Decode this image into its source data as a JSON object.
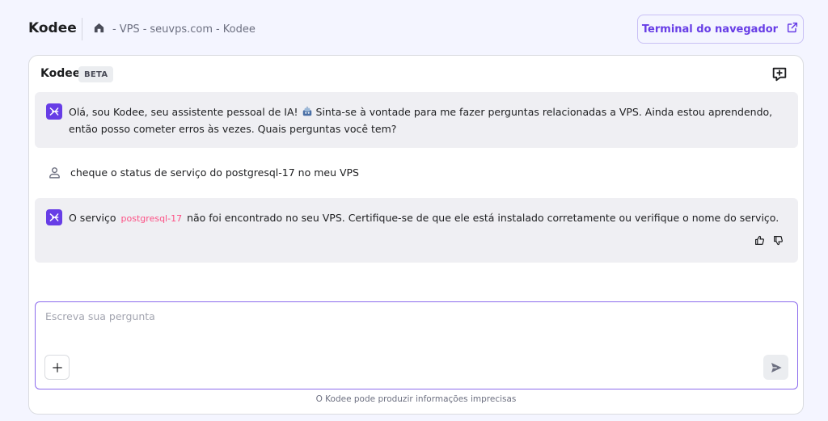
{
  "header": {
    "app_title": "Kodee",
    "breadcrumb": [
      "VPS",
      "seuvps.com",
      "Kodee"
    ],
    "terminal_button": "Terminal do navegador"
  },
  "panel": {
    "title": "Kodee",
    "badge": "BETA"
  },
  "messages": {
    "bot_intro": "Olá, sou Kodee, seu assistente pessoal de IA! ",
    "bot_intro_cont": " Sinta-se à vontade para me fazer perguntas relacionadas a VPS. Ainda estou aprendendo, então posso cometer erros às vezes. Quais perguntas você tem?",
    "user": "cheque o status de serviço do postgresql-17 no meu VPS",
    "bot_reply_pre": "O serviço",
    "bot_reply_code": "postgresql-17",
    "bot_reply_post": "não foi encontrado no seu VPS. Certifique-se de que ele está instalado corretamente ou verifique o nome do serviço."
  },
  "input": {
    "placeholder": "Escreva sua pergunta"
  },
  "disclaimer": "O Kodee pode produzir informações imprecisas",
  "colors": {
    "accent": "#673de6",
    "background": "#f4f5ff",
    "bubble": "#efeff3",
    "code": "#fc5185"
  },
  "icons": {
    "home": "home-icon",
    "external": "external-link-icon",
    "new_chat": "new-chat-icon",
    "bot": "kodee-bot-icon",
    "user": "user-icon",
    "thumbs_up": "thumbs-up-icon",
    "thumbs_down": "thumbs-down-icon",
    "add": "plus-icon",
    "send": "send-icon"
  }
}
